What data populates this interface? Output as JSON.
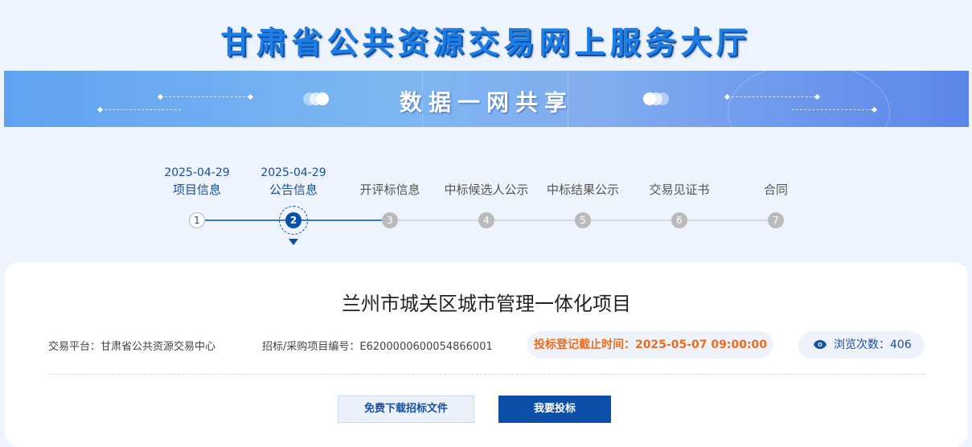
{
  "header": {
    "site_title": "甘肃省公共资源交易网上服务大厅",
    "banner_title": "数据一网共享"
  },
  "steps": [
    {
      "num": "1",
      "label": "项目信息",
      "date": "2025-04-29",
      "state": "done"
    },
    {
      "num": "2",
      "label": "公告信息",
      "date": "2025-04-29",
      "state": "active"
    },
    {
      "num": "3",
      "label": "开评标信息",
      "date": "",
      "state": "pending"
    },
    {
      "num": "4",
      "label": "中标候选人公示",
      "date": "",
      "state": "pending"
    },
    {
      "num": "5",
      "label": "中标结果公示",
      "date": "",
      "state": "pending"
    },
    {
      "num": "6",
      "label": "交易见证书",
      "date": "",
      "state": "pending"
    },
    {
      "num": "7",
      "label": "合同",
      "date": "",
      "state": "pending"
    }
  ],
  "project": {
    "title": "兰州市城关区城市管理一体化项目",
    "platform": "交易平台：甘肃省公共资源交易中心",
    "project_no": "招标/采购项目编号：E6200000600054866001",
    "deadline": "投标登记截止时间：2025-05-07 09:00:00",
    "views": "浏览次数：406"
  },
  "actions": {
    "download_label": "免费下载招标文件",
    "bid_label": "我要投标"
  },
  "colors": {
    "primary": "#0b4fa8",
    "deadline": "#f06a1a",
    "pending_step": "#bbbbbb"
  },
  "icons": {
    "views": "eye-icon",
    "active_step": "triangle-down-icon"
  }
}
